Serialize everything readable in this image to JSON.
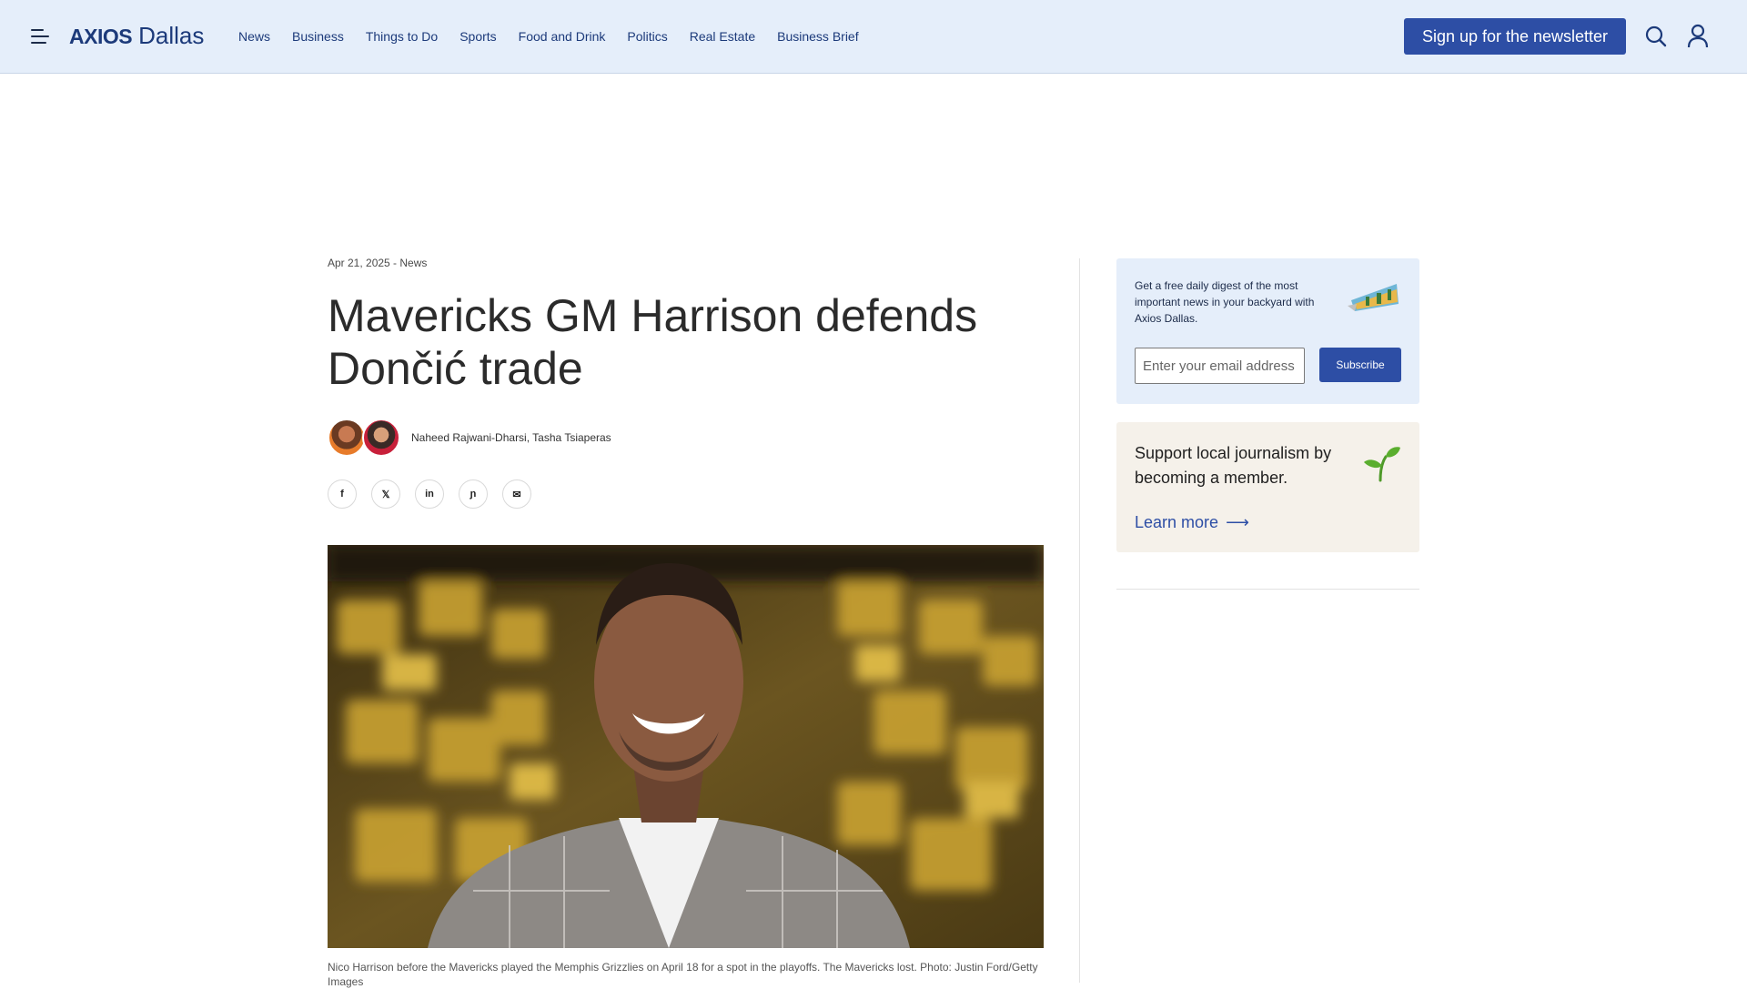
{
  "header": {
    "logo_brand": "AXIOS",
    "logo_city": "Dallas",
    "nav": [
      "News",
      "Business",
      "Things to Do",
      "Sports",
      "Food and Drink",
      "Politics",
      "Real Estate",
      "Business Brief"
    ],
    "signup_label": "Sign up for the newsletter",
    "icons": {
      "menu": "hamburger-menu-icon",
      "search": "search-icon",
      "account": "user-account-icon"
    }
  },
  "article": {
    "meta": "Apr 21, 2025 - News",
    "headline_line1": "Mavericks GM Harrison defends",
    "headline_line2": "Dončić trade",
    "authors": "Naheed Rajwani-Dharsi, Tasha Tsiaperas",
    "share": [
      {
        "name": "facebook",
        "glyph": "f"
      },
      {
        "name": "x",
        "glyph": "𝕏"
      },
      {
        "name": "linkedin",
        "glyph": "in"
      },
      {
        "name": "threads",
        "glyph": "ɲ"
      },
      {
        "name": "email",
        "glyph": "✉"
      }
    ],
    "caption": "Nico Harrison before the Mavericks played the Memphis Grizzlies on April 18 for a spot in the playoffs. The Mavericks lost. Photo: Justin Ford/Getty Images"
  },
  "sidebar": {
    "newsletter": {
      "text": "Get a free daily digest of the most important news in your backyard with Axios Dallas.",
      "email_placeholder": "Enter your email address",
      "subscribe_label": "Subscribe"
    },
    "membership": {
      "text": "Support local journalism by becoming a member.",
      "link_label": "Learn more",
      "arrow": "⟶"
    }
  },
  "colors": {
    "header_bg": "#e5eefa",
    "brand_blue": "#2d4ea5",
    "member_bg": "#f5f1ea"
  }
}
